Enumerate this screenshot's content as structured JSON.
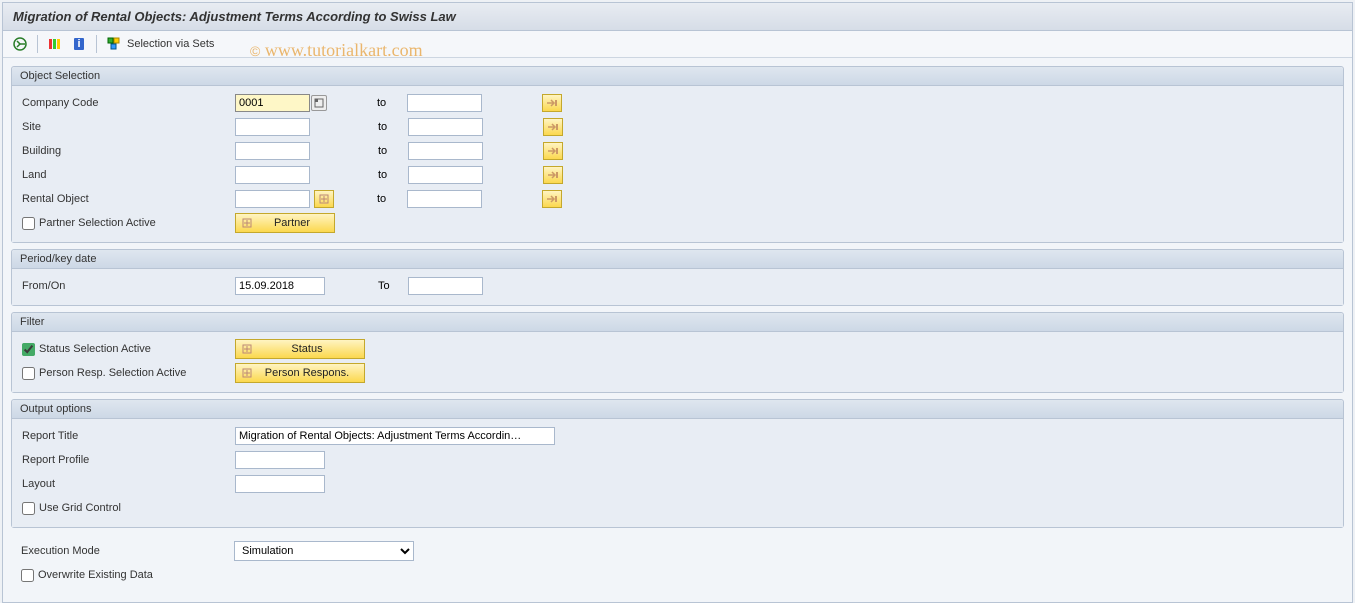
{
  "title": "Migration of Rental Objects: Adjustment Terms According to Swiss Law",
  "toolbar": {
    "selection_via_sets": "Selection via Sets"
  },
  "watermark": "© www.tutorialkart.com",
  "group_object_selection": {
    "header": "Object Selection",
    "company_code_label": "Company Code",
    "company_code_value": "0001",
    "site_label": "Site",
    "building_label": "Building",
    "land_label": "Land",
    "rental_object_label": "Rental Object",
    "to_label": "to",
    "partner_selection_label": "Partner Selection Active",
    "partner_button": "Partner"
  },
  "group_period": {
    "header": "Period/key date",
    "from_label": "From/On",
    "from_value": "15.09.2018",
    "to_label": "To"
  },
  "group_filter": {
    "header": "Filter",
    "status_selection_label": "Status Selection Active",
    "status_button": "Status",
    "person_resp_label": "Person Resp. Selection Active",
    "person_resp_button": "Person Respons."
  },
  "group_output": {
    "header": "Output options",
    "report_title_label": "Report Title",
    "report_title_value": "Migration of Rental Objects: Adjustment Terms Accordin…",
    "report_profile_label": "Report Profile",
    "layout_label": "Layout",
    "use_grid_label": "Use Grid Control"
  },
  "bottom": {
    "execution_mode_label": "Execution Mode",
    "execution_mode_value": "Simulation",
    "overwrite_label": "Overwrite Existing Data"
  }
}
